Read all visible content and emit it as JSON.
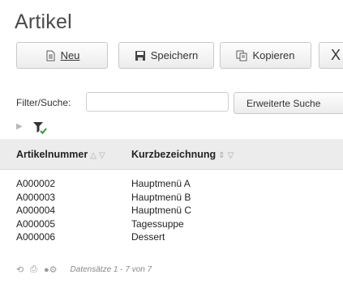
{
  "page": {
    "title": "Artikel"
  },
  "toolbar": {
    "new_label": "Neu",
    "save_label": "Speichern",
    "copy_label": "Kopieren",
    "close_label": "X"
  },
  "filter": {
    "label": "Filter/Suche:",
    "value": "",
    "advanced_label": "Erweiterte Suche"
  },
  "grid": {
    "columns": [
      "Artikelnummer",
      "Kurzbezeichnung"
    ],
    "rows": [
      [
        "A000002",
        "Hauptmenü A"
      ],
      [
        "A000003",
        "Hauptmenü B"
      ],
      [
        "A000004",
        "Hauptmenü C"
      ],
      [
        "A000005",
        "Tagessuppe"
      ],
      [
        "A000006",
        "Dessert"
      ]
    ]
  },
  "footer": {
    "records": "Datensätze 1 - 7 von 7"
  },
  "icons": {
    "new": "document-icon",
    "save": "floppy-disk-icon",
    "copy": "copy-icon",
    "filter": "filter-check-icon",
    "refresh": "refresh-icon",
    "print": "print-icon",
    "settings": "dots-icon"
  },
  "colors": {
    "header_bg": "#ececec",
    "filter_check": "#2e9c2e"
  }
}
